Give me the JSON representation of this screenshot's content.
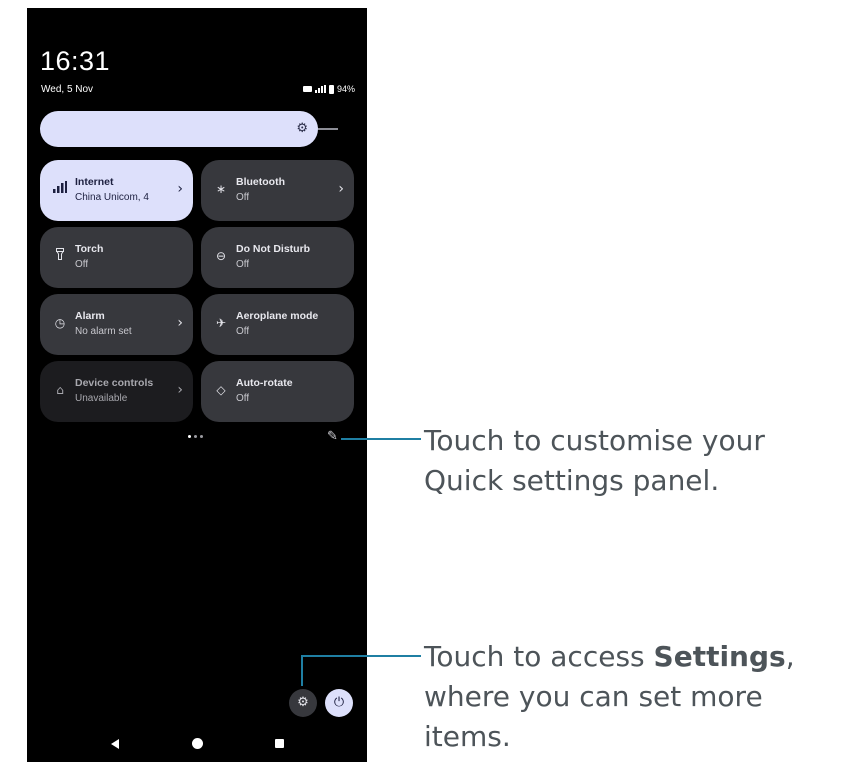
{
  "status_bar": {
    "time": "16:31",
    "date": "Wed, 5 Nov",
    "battery": "94%"
  },
  "brightness": {
    "icon": "brightness-icon"
  },
  "tiles": [
    {
      "icon": "signal-icon",
      "title": "Internet",
      "subtitle": "China Unicom, 4",
      "state": "on",
      "chevron": true
    },
    {
      "icon": "bluetooth-icon",
      "title": "Bluetooth",
      "subtitle": "Off",
      "state": "off",
      "chevron": true
    },
    {
      "icon": "torch-icon",
      "title": "Torch",
      "subtitle": "Off",
      "state": "off",
      "chevron": false
    },
    {
      "icon": "do-not-disturb-icon",
      "title": "Do Not Disturb",
      "subtitle": "Off",
      "state": "off",
      "chevron": false
    },
    {
      "icon": "alarm-icon",
      "title": "Alarm",
      "subtitle": "No alarm set",
      "state": "off",
      "chevron": true
    },
    {
      "icon": "aeroplane-icon",
      "title": "Aeroplane mode",
      "subtitle": "Off",
      "state": "off",
      "chevron": false
    },
    {
      "icon": "home-icon",
      "title": "Device controls",
      "subtitle": "Unavailable",
      "state": "dim",
      "chevron": true
    },
    {
      "icon": "auto-rotate-icon",
      "title": "Auto-rotate",
      "subtitle": "Off",
      "state": "off",
      "chevron": false
    }
  ],
  "callouts": {
    "customise": {
      "line1": "Touch to customise your",
      "line2": "Quick settings panel."
    },
    "settings": {
      "line1_pre": "Touch to access ",
      "line1_bold": "Settings",
      "line1_post": ",",
      "line2": "where you can set more",
      "line3": "items."
    }
  },
  "colors": {
    "accent": "#dde0fb",
    "tile": "#37383d",
    "leader": "#1f7fa3",
    "callout_text": "#4d5459"
  }
}
